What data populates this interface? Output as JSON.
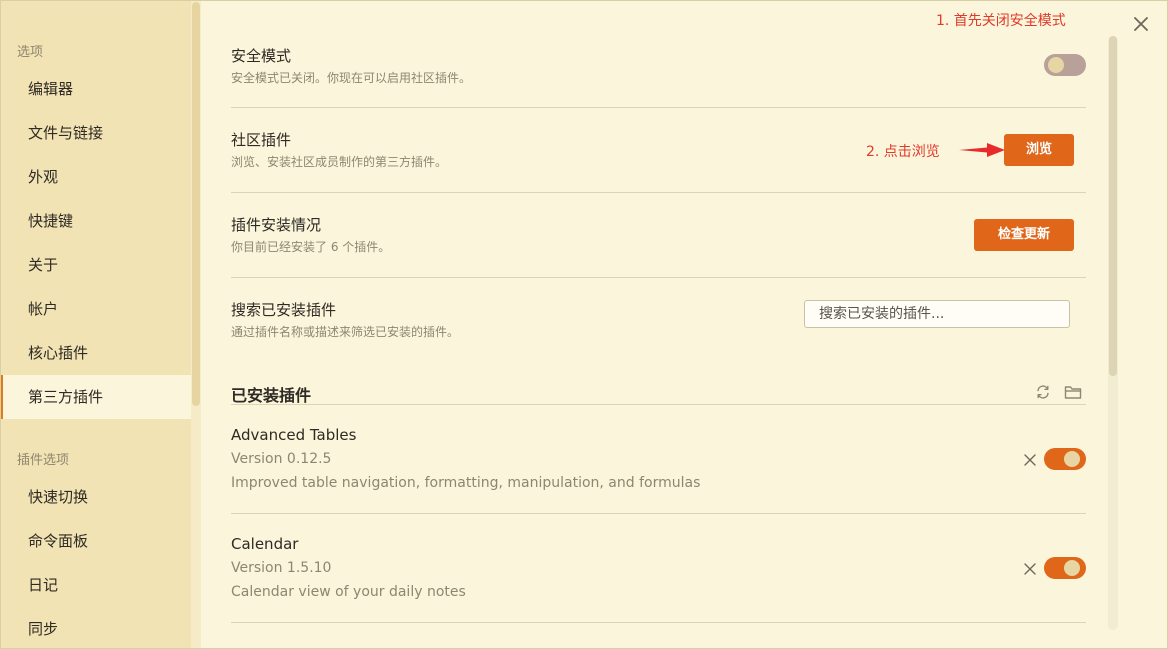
{
  "sidebar": {
    "heading_options": "选项",
    "items": [
      {
        "label": "编辑器"
      },
      {
        "label": "文件与链接"
      },
      {
        "label": "外观"
      },
      {
        "label": "快捷键"
      },
      {
        "label": "关于"
      },
      {
        "label": "帐户"
      },
      {
        "label": "核心插件"
      },
      {
        "label": "第三方插件",
        "active": true
      }
    ],
    "heading_plugin_options": "插件选项",
    "plugin_items": [
      {
        "label": "快速切换"
      },
      {
        "label": "命令面板"
      },
      {
        "label": "日记"
      },
      {
        "label": "同步"
      }
    ]
  },
  "annotations": {
    "step1": "1. 首先关闭安全模式",
    "step2": "2. 点击浏览"
  },
  "safe_mode": {
    "title": "安全模式",
    "desc": "安全模式已关闭。你现在可以启用社区插件。",
    "enabled": false
  },
  "community": {
    "title": "社区插件",
    "desc": "浏览、安装社区成员制作的第三方插件。",
    "button": "浏览"
  },
  "installed_status": {
    "title": "插件安装情况",
    "desc": "你目前已经安装了 6 个插件。",
    "button": "检查更新"
  },
  "search": {
    "title": "搜索已安装插件",
    "desc": "通过插件名称或描述来筛选已安装的插件。",
    "placeholder": "搜索已安装的插件..."
  },
  "installed": {
    "heading": "已安装插件",
    "plugins": [
      {
        "name": "Advanced Tables",
        "version": "Version 0.12.5",
        "desc": "Improved table navigation, formatting, manipulation, and formulas",
        "enabled": true
      },
      {
        "name": "Calendar",
        "version": "Version 1.5.10",
        "desc": "Calendar view of your daily notes",
        "enabled": true
      }
    ]
  },
  "colors": {
    "accent": "#e0671a",
    "annotation": "#e03a2a",
    "background": "#fbf5dc",
    "sidebar": "#f1e3b3"
  }
}
